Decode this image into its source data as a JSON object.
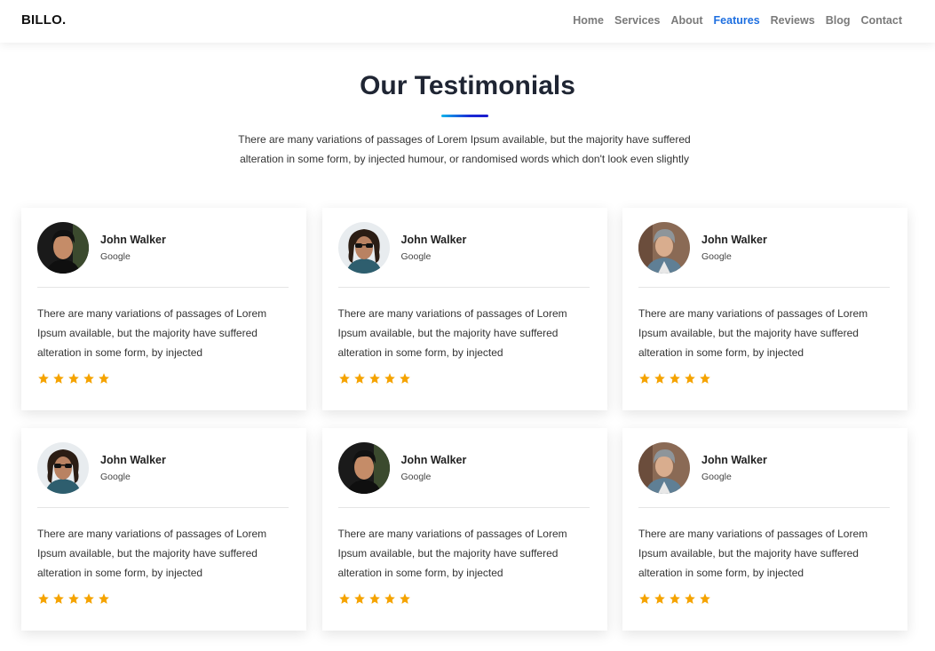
{
  "brand": "BILLO.",
  "nav": [
    {
      "label": "Home",
      "active": false
    },
    {
      "label": "Services",
      "active": false
    },
    {
      "label": "About",
      "active": false
    },
    {
      "label": "Features",
      "active": true
    },
    {
      "label": "Reviews",
      "active": false
    },
    {
      "label": "Blog",
      "active": false
    },
    {
      "label": "Contact",
      "active": false
    }
  ],
  "section": {
    "title": "Our Testimonials",
    "description": "There are many variations of passages of Lorem Ipsum available, but the majority have suffered alteration in some form, by injected humour, or randomised words which don't look even slightly"
  },
  "colors": {
    "accent": "#1e6fe0",
    "star": "#f5a300",
    "underline_start": "#12b5ea",
    "underline_end": "#1b1bcc"
  },
  "testimonials": [
    {
      "name": "John Walker",
      "company": "Google",
      "avatar": "avatar-dark-hair",
      "quote": "There are many variations of passages of Lorem Ipsum available, but the majority have suffered alteration in some form, by injected",
      "rating": 5
    },
    {
      "name": "John Walker",
      "company": "Google",
      "avatar": "avatar-sunglasses",
      "quote": "There are many variations of passages of Lorem Ipsum available, but the majority have suffered alteration in some form, by injected",
      "rating": 5
    },
    {
      "name": "John Walker",
      "company": "Google",
      "avatar": "avatar-beanie",
      "quote": "There are many variations of passages of Lorem Ipsum available, but the majority have suffered alteration in some form, by injected",
      "rating": 5
    },
    {
      "name": "John Walker",
      "company": "Google",
      "avatar": "avatar-sunglasses",
      "quote": "There are many variations of passages of Lorem Ipsum available, but the majority have suffered alteration in some form, by injected",
      "rating": 5
    },
    {
      "name": "John Walker",
      "company": "Google",
      "avatar": "avatar-dark-hair",
      "quote": "There are many variations of passages of Lorem Ipsum available, but the majority have suffered alteration in some form, by injected",
      "rating": 5
    },
    {
      "name": "John Walker",
      "company": "Google",
      "avatar": "avatar-beanie",
      "quote": "There are many variations of passages of Lorem Ipsum available, but the majority have suffered alteration in some form, by injected",
      "rating": 5
    }
  ]
}
